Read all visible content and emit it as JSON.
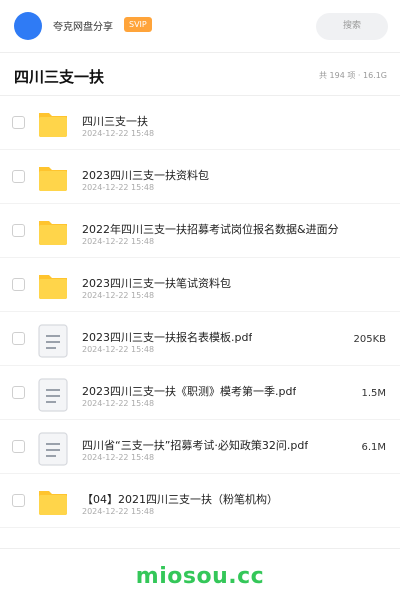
{
  "header": {
    "owner_name": "夸克网盘分享",
    "badge": "SVIP",
    "search_placeholder": "搜索"
  },
  "folder": {
    "title": "四川三支一扶",
    "summary": "共 194 项 · 16.1G"
  },
  "items": [
    {
      "type": "folder",
      "name": "四川三支一扶",
      "date": "2024-12-22 15:48",
      "size": ""
    },
    {
      "type": "folder",
      "name": "2023四川三支一扶资料包",
      "date": "2024-12-22 15:48",
      "size": ""
    },
    {
      "type": "folder",
      "name": "2022年四川三支一扶招募考试岗位报名数据&进面分",
      "date": "2024-12-22 15:48",
      "size": ""
    },
    {
      "type": "folder",
      "name": "2023四川三支一扶笔试资料包",
      "date": "2024-12-22 15:48",
      "size": ""
    },
    {
      "type": "file",
      "name": "2023四川三支一扶报名表模板.pdf",
      "date": "2024-12-22 15:48",
      "size": "205KB"
    },
    {
      "type": "file",
      "name": "2023四川三支一扶《职测》模考第一季.pdf",
      "date": "2024-12-22 15:48",
      "size": "1.5M"
    },
    {
      "type": "file",
      "name": "四川省“三支一扶”招募考试·必知政策32问.pdf",
      "date": "2024-12-22 15:48",
      "size": "6.1M"
    },
    {
      "type": "folder",
      "name": "【04】2021四川三支一扶（粉笔机构）",
      "date": "2024-12-22 15:48",
      "size": ""
    }
  ],
  "watermark": "miosou.cc",
  "colors": {
    "avatar": "#2f7bf5",
    "badge": "#ffa43a",
    "folder": "#ffc42e",
    "watermark": "#34c759"
  }
}
